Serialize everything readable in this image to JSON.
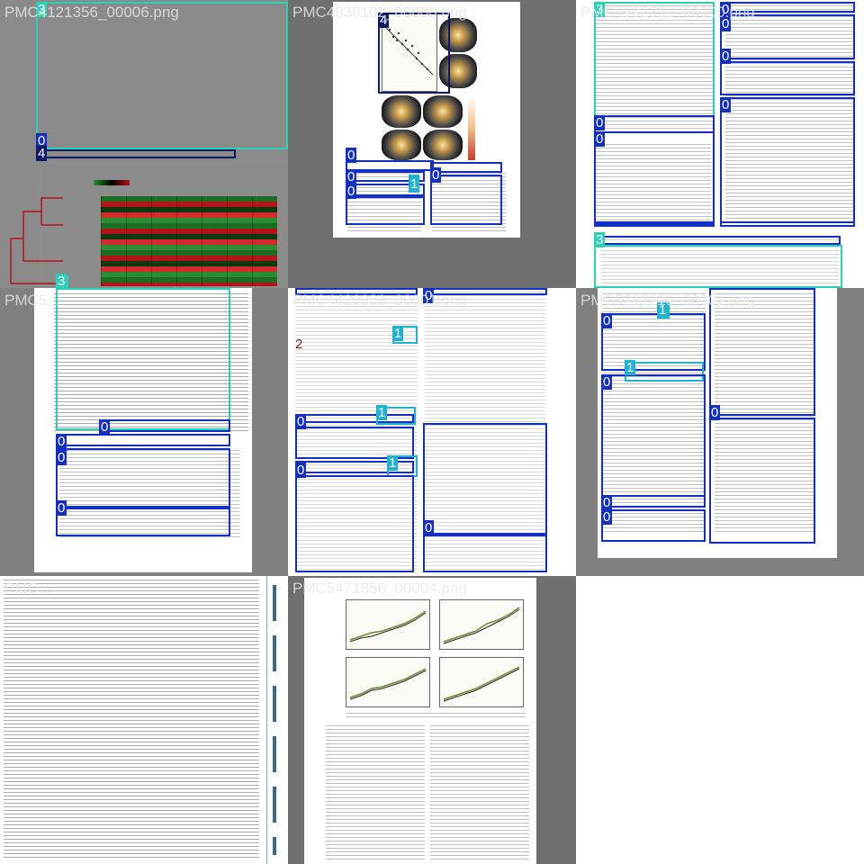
{
  "tiles": [
    {
      "title": "PMC4121356_00006.png"
    },
    {
      "title": "PMC4838102_00000.png"
    },
    {
      "title": "PMC4992322_00000.png"
    },
    {
      "title": "PMC5..."
    },
    {
      "title": "PMC4420832_00001.png"
    },
    {
      "title": "PMC5212219_00001.png"
    },
    {
      "title": "PMC..."
    },
    {
      "title": "PMC5471856_00004.png"
    }
  ],
  "labels": {
    "t1": [
      "3",
      "0",
      "4",
      "3"
    ],
    "t2": [
      "4",
      "0",
      "0",
      "0",
      "0",
      "1"
    ],
    "t3": [
      "3",
      "0",
      "0",
      "0",
      "0",
      "0",
      "0",
      "3"
    ],
    "t4": [
      "0",
      "0",
      "0",
      "0"
    ],
    "t5": [
      "0",
      "0",
      "2",
      "1",
      "0",
      "1",
      "0",
      "1",
      "0"
    ],
    "t6": [
      "0",
      "1",
      "1",
      "0",
      "0",
      "0",
      "0"
    ]
  },
  "colors": {
    "class0": "#1330c2",
    "class1": "#1fb3d2",
    "class2": "#7a1b12",
    "class3": "#2ad1b4",
    "class4": "#0c1a63"
  }
}
